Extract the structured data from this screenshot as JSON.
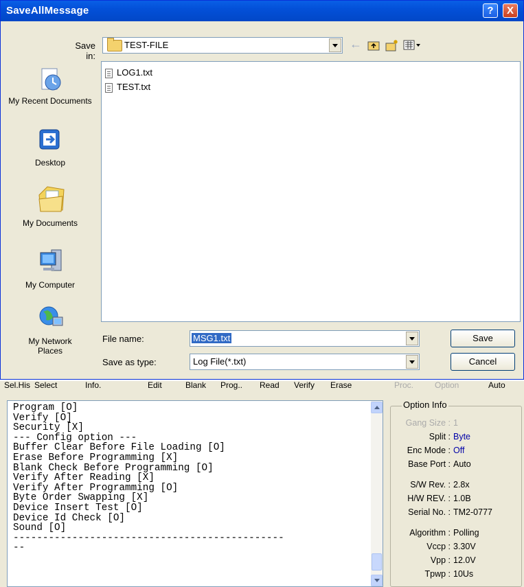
{
  "dialog": {
    "title": "SaveAllMessage",
    "help_label": "?",
    "close_label": "X",
    "save_in_label": "Save in:",
    "save_in_value": "TEST-FILE",
    "places": [
      {
        "label": "My Recent Documents",
        "icon": "recent-documents-icon"
      },
      {
        "label": "Desktop",
        "icon": "desktop-icon"
      },
      {
        "label": "My Documents",
        "icon": "my-documents-icon"
      },
      {
        "label": "My Computer",
        "icon": "my-computer-icon"
      },
      {
        "label": "My Network Places",
        "icon": "network-places-icon"
      }
    ],
    "files": [
      "LOG1.txt",
      "TEST.txt"
    ],
    "file_name_label": "File name:",
    "file_name_value": "MSG1.txt",
    "save_as_label": "Save as type:",
    "save_as_value": "Log File(*.txt)",
    "save_button": "Save",
    "cancel_button": "Cancel"
  },
  "menubar": {
    "items": [
      "Sel.His",
      "Select",
      "Info.",
      "Edit",
      "Blank",
      "Prog..",
      "Read",
      "Verify",
      "Erase",
      "Proc.",
      "Option",
      "Auto"
    ]
  },
  "log": {
    "lines": [
      "Program [O]",
      "Verify [O]",
      "Security [X]",
      "--- Config option ---",
      "Buffer Clear Before File Loading [O]",
      "Erase Before Programming [X]",
      "Blank Check Before Programming [O]",
      "Verify After Reading [X]",
      "Verify After Programming [O]",
      "Byte Order Swapping [X]",
      "Device Insert Test [O]",
      "Device Id Check [O]",
      "Sound [O]",
      "----------------------------------------------",
      "--"
    ]
  },
  "option_info": {
    "title": "Option Info",
    "rows": [
      {
        "key": "Gang Size :",
        "value": "1"
      },
      {
        "key": "Split :",
        "value": "Byte"
      },
      {
        "key": "Enc Mode :",
        "value": "Off"
      },
      {
        "key": "Base Port :",
        "value": "Auto"
      },
      {
        "key": "S/W Rev. :",
        "value": "2.8x"
      },
      {
        "key": "H/W REV. :",
        "value": "1.0B"
      },
      {
        "key": "Serial No. :",
        "value": "TM2-0777"
      },
      {
        "key": "Algorithm :",
        "value": "Polling"
      },
      {
        "key": "Vccp :",
        "value": "3.30V"
      },
      {
        "key": "Vpp :",
        "value": "12.0V"
      },
      {
        "key": "Tpwp :",
        "value": "10Us"
      }
    ]
  },
  "colors": {
    "titlebar": "#0350d8",
    "selection": "#316ac5",
    "value_blue": "#0000a8"
  }
}
